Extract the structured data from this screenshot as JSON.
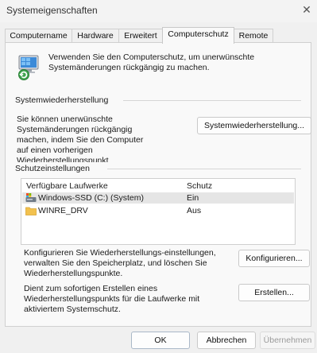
{
  "window": {
    "title": "Systemeigenschaften",
    "close_glyph": "✕"
  },
  "tabs": [
    {
      "label": "Computername"
    },
    {
      "label": "Hardware"
    },
    {
      "label": "Erweitert"
    },
    {
      "label": "Computerschutz"
    },
    {
      "label": "Remote"
    }
  ],
  "active_tab": "Computerschutz",
  "intro": {
    "icon": "system-protection-icon",
    "text": "Verwenden Sie den Computerschutz, um unerwünschte Systemänderungen rückgängig zu machen."
  },
  "restore_section": {
    "heading": "Systemwiederherstellung",
    "description": "Sie können unerwünschte Systemänderungen rückgängig machen, indem Sie den Computer auf einen vorherigen Wiederherstellungspunkt zurücksetzen.",
    "button": "Systemwiederherstellung..."
  },
  "protection_section": {
    "heading": "Schutzeinstellungen",
    "columns": [
      "Verfügbare Laufwerke",
      "Schutz"
    ],
    "drives": [
      {
        "name": "Windows-SSD (C:) (System)",
        "status": "Ein",
        "icon": "system-drive-icon"
      },
      {
        "name": "WINRE_DRV",
        "status": "Aus",
        "icon": "folder-icon"
      }
    ],
    "configure_text": "Konfigurieren Sie Wiederherstellungs-einstellungen, verwalten Sie den Speicherplatz, und löschen Sie Wiederherstellungspunkte.",
    "configure_button": "Konfigurieren...",
    "create_text": "Dient zum sofortigen Erstellen eines Wiederherstellungspunkts für die Laufwerke mit aktiviertem Systemschutz.",
    "create_button": "Erstellen..."
  },
  "footer": {
    "ok": "OK",
    "cancel": "Abbrechen",
    "apply": "Übernehmen"
  },
  "colors": {
    "background": "#f0f0f0",
    "panel": "#f9f9f9",
    "selected_row": "#e5e5e5",
    "folder": "#f2c14e",
    "disabled_text": "#9a9a9a"
  }
}
